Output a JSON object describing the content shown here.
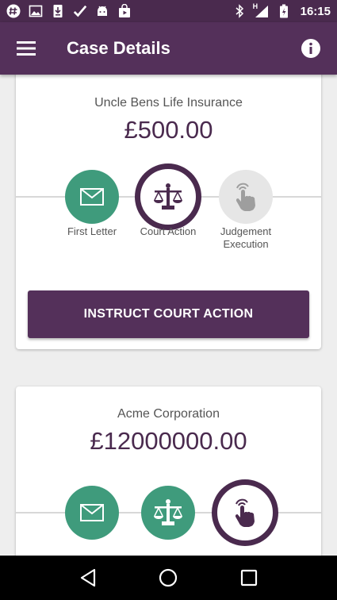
{
  "status_bar": {
    "time": "16:15",
    "left_icons": [
      "hashtag-icon",
      "image-icon",
      "download-icon",
      "check-icon",
      "android-icon",
      "store-icon"
    ],
    "right_icons": [
      "bluetooth-icon",
      "signal-icon",
      "battery-icon"
    ],
    "signal_label": "H"
  },
  "app_bar": {
    "title": "Case Details"
  },
  "cases": [
    {
      "company": "Uncle Bens Life Insurance",
      "amount": "£500.00",
      "steps": [
        {
          "label": "First Letter",
          "state": "done"
        },
        {
          "label": "Court Action",
          "state": "current"
        },
        {
          "label": "Judgement Execution",
          "state": "pending"
        }
      ],
      "action_label": "INSTRUCT COURT ACTION"
    },
    {
      "company": "Acme Corporation",
      "amount": "£12000000.00",
      "steps": [
        {
          "label": "",
          "state": "done"
        },
        {
          "label": "",
          "state": "done"
        },
        {
          "label": "",
          "state": "current"
        }
      ]
    }
  ],
  "colors": {
    "primary": "#54305a",
    "primary_dark": "#4a2a4e",
    "done_green": "#3f9b7c",
    "pending_gray": "#e6e6e6"
  }
}
